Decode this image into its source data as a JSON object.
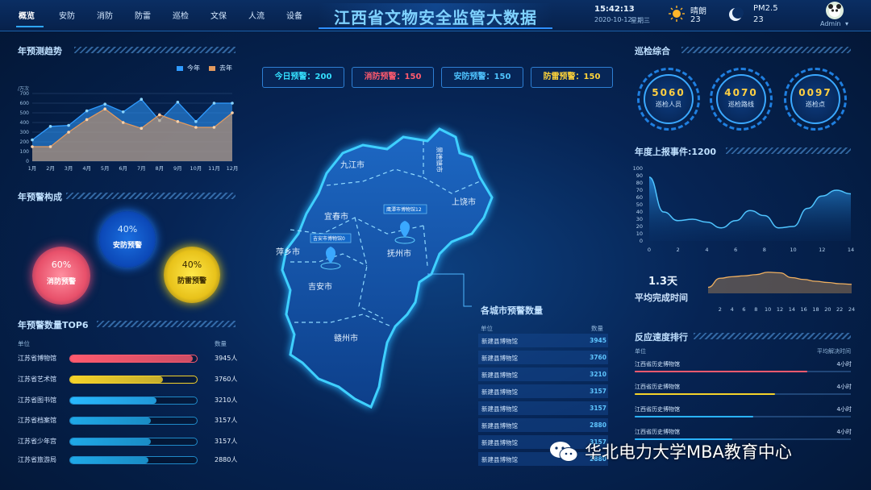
{
  "nav": [
    "概览",
    "安防",
    "消防",
    "防雷",
    "巡检",
    "文保",
    "人流",
    "设备"
  ],
  "title": "江西省文物安全监管大数据",
  "header": {
    "time": "15:42:13",
    "date": "2020-10-12",
    "weekday": "星期三",
    "weather": "晴朗",
    "weather_value": "23",
    "pm_label": "PM2.5",
    "pm_value": "23",
    "user": "Admin"
  },
  "trend": {
    "title": "年预测趋势",
    "legend_this": "今年",
    "legend_last": "去年",
    "unit": "/万次",
    "chart_data": {
      "type": "area",
      "x": [
        "1月",
        "2月",
        "3月",
        "4月",
        "5月",
        "6月",
        "7月",
        "8月",
        "9月",
        "10月",
        "11月",
        "12月"
      ],
      "series": [
        {
          "name": "今年",
          "values": [
            220,
            360,
            370,
            520,
            590,
            510,
            640,
            420,
            610,
            410,
            600,
            600
          ]
        },
        {
          "name": "去年",
          "values": [
            150,
            150,
            300,
            430,
            540,
            400,
            340,
            480,
            410,
            350,
            350,
            500
          ]
        }
      ],
      "yticks": [
        0,
        100,
        200,
        300,
        400,
        500,
        600,
        700
      ],
      "ylim": [
        0,
        700
      ]
    },
    "colors": {
      "this": "#2f9bff",
      "last": "#e29a5f"
    }
  },
  "composition": {
    "title": "年预警构成",
    "items": [
      {
        "pct": "40%",
        "label": "安防预警"
      },
      {
        "pct": "60%",
        "label": "消防预警"
      },
      {
        "pct": "40%",
        "label": "防雷预警"
      }
    ]
  },
  "top6": {
    "title": "年预警数量TOP6",
    "col_unit": "单位",
    "col_count": "数量",
    "rows": [
      {
        "name": "江苏省博物馆",
        "value": "3945人",
        "pct": 0.97,
        "color": "#ff5a6e"
      },
      {
        "name": "江苏省艺术馆",
        "value": "3760人",
        "pct": 0.73,
        "color": "#f5d32a"
      },
      {
        "name": "江苏省图书馆",
        "value": "3210人",
        "pct": 0.68,
        "color": "#28b8ff"
      },
      {
        "name": "江苏省档案馆",
        "value": "3157人",
        "pct": 0.64,
        "color": "#1fa9e8"
      },
      {
        "name": "江苏省少年宫",
        "value": "3157人",
        "pct": 0.64,
        "color": "#1fa9e8"
      },
      {
        "name": "江苏省旅游局",
        "value": "2880人",
        "pct": 0.62,
        "color": "#1fa9e8"
      }
    ]
  },
  "stats": [
    {
      "label": "今日预警：200",
      "color": "#35e0ff"
    },
    {
      "label": "消防预警：150",
      "color": "#ff5a6e"
    },
    {
      "label": "安防预警：150",
      "color": "#4fc4ff"
    },
    {
      "label": "防雷预警：150",
      "color": "#ffd43a"
    }
  ],
  "map": {
    "cities": [
      "九江市",
      "景德镇市",
      "上饶市",
      "宜春市",
      "萍乡市",
      "吉安市",
      "抚州市",
      "赣州市"
    ],
    "tag1": "鹰潭市博物馆12",
    "tag2": "吉安市博物馆0"
  },
  "city_table": {
    "title": "各城市预警数量",
    "col_unit": "单位",
    "col_count": "数量",
    "rows": [
      {
        "name": "新建县博物馆",
        "value": "3945"
      },
      {
        "name": "新建县博物馆",
        "value": "3760"
      },
      {
        "name": "新建县博物馆",
        "value": "3210"
      },
      {
        "name": "新建县博物馆",
        "value": "3157"
      },
      {
        "name": "新建县博物馆",
        "value": "3157"
      },
      {
        "name": "新建县博物馆",
        "value": "2880"
      },
      {
        "name": "新建县博物馆",
        "value": "3157"
      },
      {
        "name": "新建县博物馆",
        "value": "2880"
      }
    ]
  },
  "patrol": {
    "title": "巡检综合",
    "items": [
      {
        "value": "5060",
        "label": "巡检人员"
      },
      {
        "value": "4070",
        "label": "巡检路线"
      },
      {
        "value": "0097",
        "label": "巡检点"
      }
    ]
  },
  "events": {
    "title": "年度上报事件:1200",
    "chart_data": {
      "type": "area",
      "x": [
        0,
        1,
        2,
        3,
        4,
        5,
        6,
        7,
        8,
        9,
        10,
        11,
        12,
        13,
        14
      ],
      "values": [
        88,
        40,
        28,
        30,
        26,
        18,
        28,
        42,
        35,
        18,
        20,
        45,
        62,
        70,
        65
      ],
      "xticks": [
        0,
        2,
        4,
        6,
        8,
        10,
        12,
        14
      ],
      "yticks": [
        0,
        10,
        20,
        30,
        40,
        50,
        60,
        70,
        80,
        90,
        100
      ],
      "ylim": [
        0,
        100
      ]
    }
  },
  "avg": {
    "value": "1.3天",
    "label": "平均完成时间",
    "chart_data": {
      "type": "area",
      "x": [
        0,
        2,
        4,
        6,
        8,
        10,
        12,
        14,
        16,
        18,
        20,
        22,
        24
      ],
      "values": [
        20,
        50,
        55,
        58,
        62,
        70,
        68,
        52,
        46,
        40,
        36,
        32,
        30
      ],
      "xticks": [
        2,
        4,
        6,
        8,
        10,
        12,
        14,
        16,
        18,
        20,
        22,
        24
      ]
    }
  },
  "speed": {
    "title": "反应速度排行",
    "col_unit": "单位",
    "col_time": "平均解决时间",
    "rows": [
      {
        "name": "江西省历史博物馆",
        "value": "4小时",
        "pct": 0.8,
        "color": "#ff5a6e"
      },
      {
        "name": "江西省历史博物馆",
        "value": "4小时",
        "pct": 0.65,
        "color": "#f5d32a"
      },
      {
        "name": "江西省历史博物馆",
        "value": "4小时",
        "pct": 0.55,
        "color": "#2ab3ff"
      },
      {
        "name": "江西省历史博物馆",
        "value": "4小时",
        "pct": 0.45,
        "color": "#2ab3ff"
      }
    ]
  },
  "watermark": "华北电力大学MBA教育中心"
}
